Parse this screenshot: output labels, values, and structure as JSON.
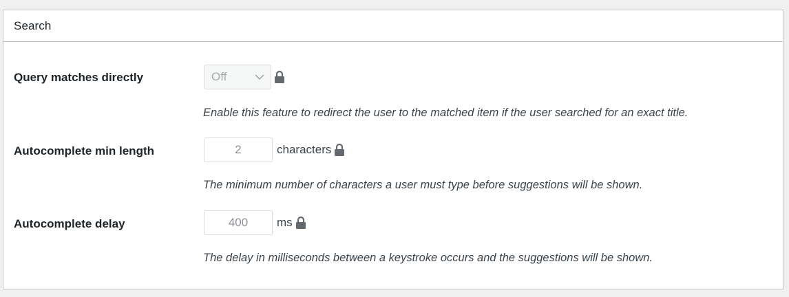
{
  "panel": {
    "title": "Search"
  },
  "settings": [
    {
      "label": "Query matches directly",
      "control_type": "select",
      "value": "Off",
      "locked": true,
      "description": "Enable this feature to redirect the user to the matched item if the user searched for an exact title."
    },
    {
      "label": "Autocomplete min length",
      "control_type": "number",
      "value": "2",
      "unit": "characters",
      "locked": true,
      "description": "The minimum number of characters a user must type before suggestions will be shown."
    },
    {
      "label": "Autocomplete delay",
      "control_type": "number",
      "value": "400",
      "unit": "ms",
      "locked": true,
      "description": "The delay in milliseconds between a keystroke occurs and the suggestions will be shown."
    }
  ],
  "icons": {
    "lock": "lock-icon",
    "select_arrow": "chevron-down-icon"
  },
  "colors": {
    "lock": "#646970",
    "disabled_text": "#a7aaad",
    "border": "#c3c4c7"
  }
}
